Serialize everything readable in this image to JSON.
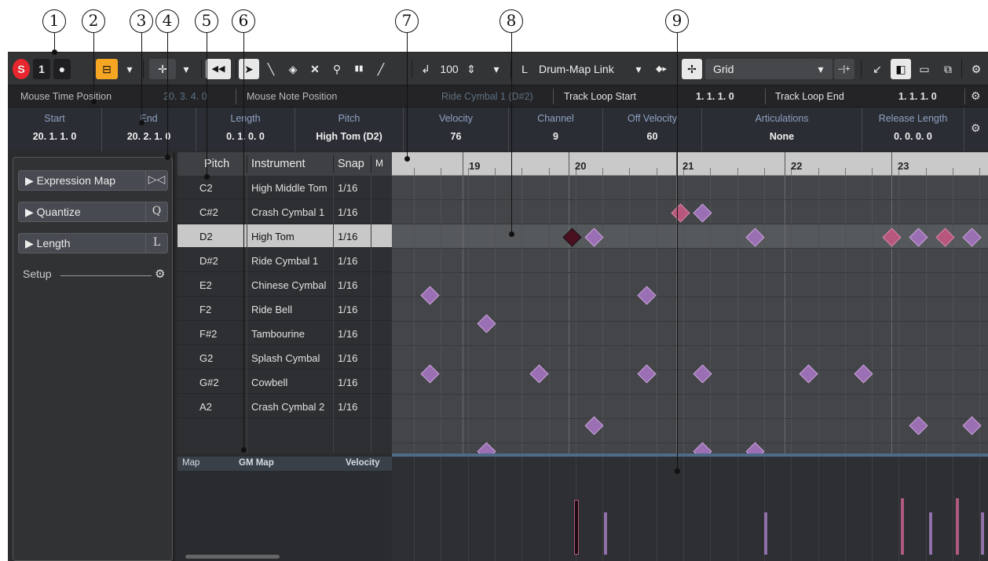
{
  "callouts": [
    "1",
    "2",
    "3",
    "4",
    "5",
    "6",
    "7",
    "8",
    "9"
  ],
  "toolbar": {
    "solo": "S",
    "one": "1",
    "record": "●",
    "auto_scroll": "⊟",
    "dropdown": "▾",
    "step_input": "✛",
    "speaker": "◀◀",
    "object_select": "➤",
    "draw": "╲",
    "erase": "◈",
    "delete": "✕",
    "zoom": "⚲",
    "mute": "▮▮",
    "line": "╱",
    "insert_velocity_icon": "↲",
    "insert_velocity": "100",
    "updown": "⇕",
    "snap_icon": "L",
    "quantize_link": "Drum-Map Link",
    "snap_arrows": "◆▸",
    "grid_icon": "✢",
    "grid_type": "Grid",
    "grid_offset": "–|+",
    "view_in": "↙",
    "left_zone": "◧",
    "lower_zone": "▭",
    "window_out": "⧉",
    "settings": "⚙"
  },
  "infoline": {
    "mouse_time_label": "Mouse Time Position",
    "mouse_time_value": "20. 3. 4.   0",
    "mouse_note_label": "Mouse Note Position",
    "mouse_note_value": "Ride Cymbal 1 (D#2)",
    "loop_start_label": "Track Loop Start",
    "loop_start_value": "1.  1.  1.   0",
    "loop_end_label": "Track Loop End",
    "loop_end_value": "1.  1.  1.   0"
  },
  "eventinfo": [
    {
      "label": "Start",
      "value": "20.  1.  1.   0"
    },
    {
      "label": "End",
      "value": "20.  2.  1.   0"
    },
    {
      "label": "Length",
      "value": "0.  1.  0.   0"
    },
    {
      "label": "Pitch",
      "value": "High Tom (D2)"
    },
    {
      "label": "Velocity",
      "value": "76"
    },
    {
      "label": "Channel",
      "value": "9"
    },
    {
      "label": "Off Velocity",
      "value": "60"
    },
    {
      "label": "Articulations",
      "value": "None"
    },
    {
      "label": "Release Length",
      "value": "0.  0.  0.   0"
    }
  ],
  "inspector": {
    "sections": [
      {
        "label": "Expression Map",
        "icon": "▷◁"
      },
      {
        "label": "Quantize",
        "icon": "Q"
      },
      {
        "label": "Length",
        "icon": "L"
      }
    ],
    "setup_label": "Setup"
  },
  "drumlist": {
    "headers": {
      "pitch": "Pitch",
      "instrument": "Instrument",
      "snap": "Snap",
      "more": "M"
    },
    "rows": [
      {
        "pitch": "C2",
        "instrument": "High Middle Tom",
        "snap": "1/16"
      },
      {
        "pitch": "C#2",
        "instrument": "Crash Cymbal 1",
        "snap": "1/16"
      },
      {
        "pitch": "D2",
        "instrument": "High Tom",
        "snap": "1/16"
      },
      {
        "pitch": "D#2",
        "instrument": "Ride Cymbal 1",
        "snap": "1/16"
      },
      {
        "pitch": "E2",
        "instrument": "Chinese Cymbal",
        "snap": "1/16"
      },
      {
        "pitch": "F2",
        "instrument": "Ride Bell",
        "snap": "1/16"
      },
      {
        "pitch": "F#2",
        "instrument": "Tambourine",
        "snap": "1/16"
      },
      {
        "pitch": "G2",
        "instrument": "Splash Cymbal",
        "snap": "1/16"
      },
      {
        "pitch": "G#2",
        "instrument": "Cowbell",
        "snap": "1/16"
      },
      {
        "pitch": "A2",
        "instrument": "Crash Cymbal 2",
        "snap": "1/16"
      }
    ]
  },
  "ruler": {
    "bars": [
      "19",
      "20",
      "21",
      "22",
      "23"
    ]
  },
  "controller": {
    "map_label": "Map",
    "map_value": "GM Map",
    "lane": "Velocity"
  },
  "colors": {
    "note": "#9b6fb3",
    "note_selected_row": "#b8577c",
    "accent_orange": "#f5a623",
    "solo_red": "#e8262e"
  }
}
